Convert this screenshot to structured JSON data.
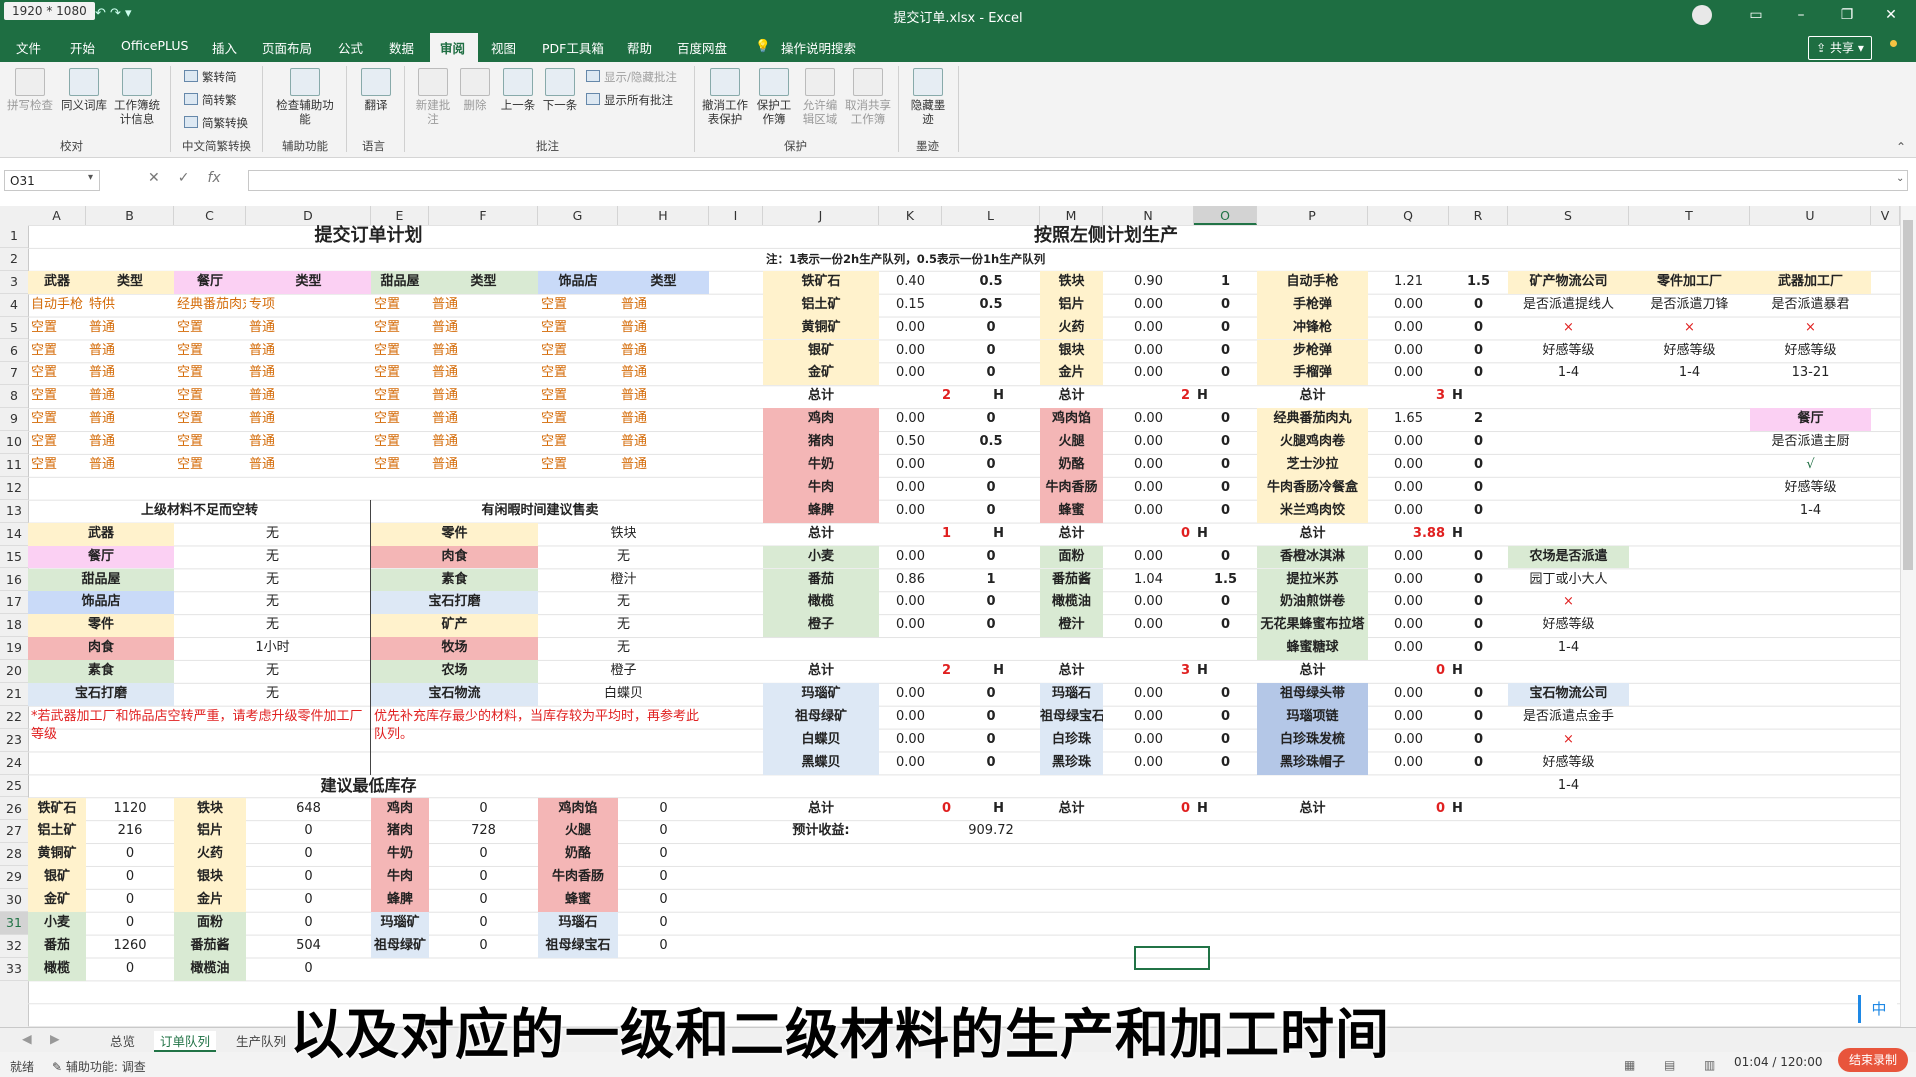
{
  "window": {
    "resolution_badge": "1920 * 1080",
    "title": "提交订单.xlsx - Excel"
  },
  "tabs": [
    "文件",
    "开始",
    "OfficePLUS",
    "插入",
    "页面布局",
    "公式",
    "数据",
    "审阅",
    "视图",
    "PDF工具箱",
    "帮助",
    "百度网盘"
  ],
  "tell_me": "操作说明搜索",
  "share": "共享",
  "ribbon": {
    "proof": {
      "spell": "拼写检查",
      "thesaurus": "同义词库",
      "stats": "工作簿统计信息",
      "group": "校对"
    },
    "chinese": {
      "t2s": "繁转简",
      "s2t": "简转繁",
      "conv": "简繁转换",
      "group": "中文简繁转换"
    },
    "access": {
      "check": "检查辅助功能",
      "group": "辅助功能"
    },
    "lang": {
      "translate": "翻译",
      "group": "语言"
    },
    "comments": {
      "new": "新建批注",
      "del": "删除",
      "prev": "上一条",
      "next": "下一条",
      "show_hide": "显示/隐藏批注",
      "show_all": "显示所有批注",
      "group": "批注"
    },
    "protect": {
      "unprotect_sheet": "撤消工作表保护",
      "protect_wb": "保护工作簿",
      "allow_edit": "允许编辑区域",
      "unshare": "取消共享工作簿",
      "group": "保护"
    },
    "ink": {
      "hide": "隐藏墨迹",
      "group": "墨迹"
    }
  },
  "namebox": "O31",
  "columns": [
    "A",
    "B",
    "C",
    "D",
    "E",
    "F",
    "G",
    "H",
    "I",
    "J",
    "K",
    "L",
    "M",
    "N",
    "O",
    "P",
    "Q",
    "R",
    "S",
    "T",
    "U",
    "V"
  ],
  "rows": [
    "1",
    "2",
    "3",
    "4",
    "5",
    "6",
    "7",
    "8",
    "9",
    "10",
    "11",
    "12",
    "13",
    "14",
    "15",
    "16",
    "17",
    "18",
    "19",
    "20",
    "21",
    "22",
    "23",
    "24",
    "25",
    "26",
    "27",
    "28",
    "29",
    "30",
    "31",
    "32",
    "33"
  ],
  "left": {
    "title": "提交订单计划",
    "headers": [
      "武器",
      "类型",
      "餐厅",
      "类型",
      "甜品屋",
      "类型",
      "饰品店",
      "类型"
    ],
    "orders": [
      [
        "自动手枪",
        "特供",
        "经典番茄肉丸",
        "专项",
        "空置",
        "普通",
        "空置",
        "普通"
      ],
      [
        "空置",
        "普通",
        "空置",
        "普通",
        "空置",
        "普通",
        "空置",
        "普通"
      ],
      [
        "空置",
        "普通",
        "空置",
        "普通",
        "空置",
        "普通",
        "空置",
        "普通"
      ],
      [
        "空置",
        "普通",
        "空置",
        "普通",
        "空置",
        "普通",
        "空置",
        "普通"
      ],
      [
        "空置",
        "普通",
        "空置",
        "普通",
        "空置",
        "普通",
        "空置",
        "普通"
      ],
      [
        "空置",
        "普通",
        "空置",
        "普通",
        "空置",
        "普通",
        "空置",
        "普通"
      ],
      [
        "空置",
        "普通",
        "空置",
        "普通",
        "空置",
        "普通",
        "空置",
        "普通"
      ],
      [
        "空置",
        "普通",
        "空置",
        "普通",
        "空置",
        "普通",
        "空置",
        "普通"
      ]
    ],
    "shortage_title": "上级材料不足而空转",
    "shortage": [
      [
        "武器",
        "无"
      ],
      [
        "餐厅",
        "无"
      ],
      [
        "甜品屋",
        "无"
      ],
      [
        "饰品店",
        "无"
      ],
      [
        "零件",
        "无"
      ],
      [
        "肉食",
        "1小时"
      ],
      [
        "素食",
        "无"
      ],
      [
        "宝石打磨",
        "无"
      ]
    ],
    "idle_title": "有闲暇时间建议售卖",
    "idle": [
      [
        "零件",
        "铁块"
      ],
      [
        "肉食",
        "无"
      ],
      [
        "素食",
        "橙汁"
      ],
      [
        "宝石打磨",
        "无"
      ],
      [
        "矿产",
        "无"
      ],
      [
        "牧场",
        "无"
      ],
      [
        "农场",
        "橙子"
      ],
      [
        "宝石物流",
        "白蝶贝"
      ]
    ],
    "note_left": "*若武器加工厂和饰品店空转严重，请考虑升级零件加工厂等级",
    "note_right": "优先补充库存最少的材料，当库存较为平均时，再参考此队列。",
    "stock_title": "建议最低库存",
    "stock": [
      [
        "铁矿石",
        "1120",
        "铁块",
        "648",
        "鸡肉",
        "0",
        "鸡肉馅",
        "0"
      ],
      [
        "铝土矿",
        "216",
        "铝片",
        "0",
        "猪肉",
        "728",
        "火腿",
        "0"
      ],
      [
        "黄铜矿",
        "0",
        "火药",
        "0",
        "牛奶",
        "0",
        "奶酪",
        "0"
      ],
      [
        "银矿",
        "0",
        "银块",
        "0",
        "牛肉",
        "0",
        "牛肉香肠",
        "0"
      ],
      [
        "金矿",
        "0",
        "金片",
        "0",
        "蜂脾",
        "0",
        "蜂蜜",
        "0"
      ],
      [
        "小麦",
        "0",
        "面粉",
        "0",
        "玛瑙矿",
        "0",
        "玛瑙石",
        "0"
      ],
      [
        "番茄",
        "1260",
        "番茄酱",
        "504",
        "祖母绿矿",
        "0",
        "祖母绿宝石",
        "0"
      ],
      [
        "橄榄",
        "0",
        "橄榄油",
        "0",
        "",
        "",
        "",
        ""
      ]
    ]
  },
  "right": {
    "title": "按照左侧计划生产",
    "note": "注：1表示一份2h生产队列，0.5表示一份1h生产队列",
    "blocks": [
      {
        "rows": [
          [
            "铁矿石",
            "0.40",
            "0.5",
            "铁块",
            "0.90",
            "1",
            "自动手枪",
            "1.21",
            "1.5"
          ],
          [
            "铝土矿",
            "0.15",
            "0.5",
            "铝片",
            "0.00",
            "0",
            "手枪弹",
            "0.00",
            "0"
          ],
          [
            "黄铜矿",
            "0.00",
            "0",
            "火药",
            "0.00",
            "0",
            "冲锋枪",
            "0.00",
            "0"
          ],
          [
            "银矿",
            "0.00",
            "0",
            "银块",
            "0.00",
            "0",
            "步枪弹",
            "0.00",
            "0"
          ],
          [
            "金矿",
            "0.00",
            "0",
            "金片",
            "0.00",
            "0",
            "手榴弹",
            "0.00",
            "0"
          ]
        ],
        "totals": [
          "2",
          "2",
          "3"
        ]
      },
      {
        "rows": [
          [
            "鸡肉",
            "0.00",
            "0",
            "鸡肉馅",
            "0.00",
            "0",
            "经典番茄肉丸",
            "1.65",
            "2"
          ],
          [
            "猪肉",
            "0.50",
            "0.5",
            "火腿",
            "0.00",
            "0",
            "火腿鸡肉卷",
            "0.00",
            "0"
          ],
          [
            "牛奶",
            "0.00",
            "0",
            "奶酪",
            "0.00",
            "0",
            "芝士沙拉",
            "0.00",
            "0"
          ],
          [
            "牛肉",
            "0.00",
            "0",
            "牛肉香肠",
            "0.00",
            "0",
            "牛肉香肠冷餐盒",
            "0.00",
            "0"
          ],
          [
            "蜂脾",
            "0.00",
            "0",
            "蜂蜜",
            "0.00",
            "0",
            "米兰鸡肉饺",
            "0.00",
            "0"
          ]
        ],
        "totals": [
          "1",
          "0",
          "3.88"
        ]
      },
      {
        "rows": [
          [
            "小麦",
            "0.00",
            "0",
            "面粉",
            "0.00",
            "0",
            "香橙冰淇淋",
            "0.00",
            "0"
          ],
          [
            "番茄",
            "0.86",
            "1",
            "番茄酱",
            "1.04",
            "1.5",
            "提拉米苏",
            "0.00",
            "0"
          ],
          [
            "橄榄",
            "0.00",
            "0",
            "橄榄油",
            "0.00",
            "0",
            "奶油煎饼卷",
            "0.00",
            "0"
          ],
          [
            "橙子",
            "0.00",
            "0",
            "橙汁",
            "0.00",
            "0",
            "无花果蜂蜜布拉塔",
            "0.00",
            "0"
          ],
          [
            "",
            "",
            "",
            "",
            "",
            "",
            "蜂蜜糖球",
            "0.00",
            "0"
          ]
        ],
        "totals": [
          "2",
          "3",
          "0"
        ]
      },
      {
        "rows": [
          [
            "玛瑙矿",
            "0.00",
            "0",
            "玛瑙石",
            "0.00",
            "0",
            "祖母绿头带",
            "0.00",
            "0"
          ],
          [
            "祖母绿矿",
            "0.00",
            "0",
            "祖母绿宝石",
            "0.00",
            "0",
            "玛瑙项链",
            "0.00",
            "0"
          ],
          [
            "白蝶贝",
            "0.00",
            "0",
            "白珍珠",
            "0.00",
            "0",
            "白珍珠发梳",
            "0.00",
            "0"
          ],
          [
            "黑蝶贝",
            "0.00",
            "0",
            "黑珍珠",
            "0.00",
            "0",
            "黑珍珠帽子",
            "0.00",
            "0"
          ]
        ],
        "totals": [
          "0",
          "0",
          "0"
        ]
      }
    ],
    "total_label": "总计",
    "hour_unit": "H",
    "income_label": "预计收益:",
    "income_value": "909.72"
  },
  "side": {
    "col_s": [
      "矿产物流公司",
      "是否派遣提线人",
      "×",
      "好感等级",
      "1-4"
    ],
    "col_t": [
      "零件加工厂",
      "是否派遣刀锋",
      "×",
      "好感等级",
      "1-4"
    ],
    "col_u": [
      "武器加工厂",
      "是否派遣暴君",
      "×",
      "好感等级",
      "13-21"
    ],
    "restaurant": [
      "餐厅",
      "是否派遣主厨",
      "√",
      "好感等级",
      "1-4"
    ],
    "farm": [
      "农场是否派遣",
      "园丁或小大人",
      "×",
      "好感等级",
      "1-4"
    ],
    "gem": [
      "宝石物流公司",
      "是否派遣点金手",
      "×",
      "好感等级",
      "1-4"
    ]
  },
  "sheets": [
    "总览",
    "订单队列",
    "生产队列"
  ],
  "status": {
    "ready": "就绪",
    "accessibility": "辅助功能: 调查",
    "timer": "01:04 / 120:00",
    "end_record": "结束录制"
  },
  "ime": "中",
  "subtitle": "以及对应的一级和二级材料的生产和加工时间",
  "colors": {
    "excel_green": "#1e6e42",
    "accent": "#217346"
  }
}
